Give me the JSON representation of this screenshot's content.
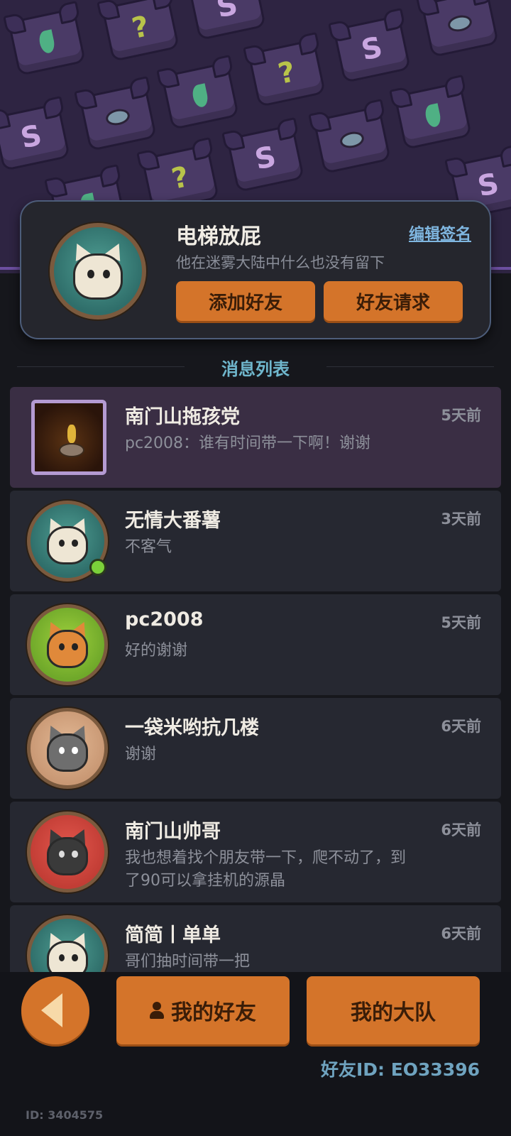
{
  "profile": {
    "name": "电梯放屁",
    "edit_signature": "编辑签名",
    "signature": "他在迷雾大陆中什么也没有留下",
    "add_friend": "添加好友",
    "friend_requests": "好友请求"
  },
  "section_title": "消息列表",
  "messages": [
    {
      "name": "南门山拖孩党",
      "time": "5天前",
      "text": "pc2008：谁有时间带一下啊！谢谢",
      "avatar_icon": "group-cauldron-icon"
    },
    {
      "name": "无情大番薯",
      "time": "3天前",
      "text": "不客气",
      "avatar_icon": "cat-avatar-icon",
      "online": true
    },
    {
      "name": "pc2008",
      "time": "5天前",
      "text": "好的谢谢",
      "avatar_icon": "fox-avatar-icon"
    },
    {
      "name": "一袋米哟抗几楼",
      "time": "6天前",
      "text": "谢谢",
      "avatar_icon": "raccoon-avatar-icon"
    },
    {
      "name": "南门山帅哥",
      "time": "6天前",
      "text": "我也想着找个朋友带一下，爬不动了，到了90可以拿挂机的源晶",
      "avatar_icon": "hooded-cat-avatar-icon"
    },
    {
      "name": "简简丨单单",
      "time": "6天前",
      "text": "哥们抽时间带一把",
      "avatar_icon": "cat-avatar-icon"
    }
  ],
  "bottom": {
    "my_friends": "我的好友",
    "my_team": "我的大队",
    "friend_id": "好友ID: EO33396",
    "user_id": "ID: 3404575"
  },
  "colors": {
    "accent_orange": "#d4742a",
    "section_title": "#6fb6cc",
    "online": "#7bd13a"
  }
}
